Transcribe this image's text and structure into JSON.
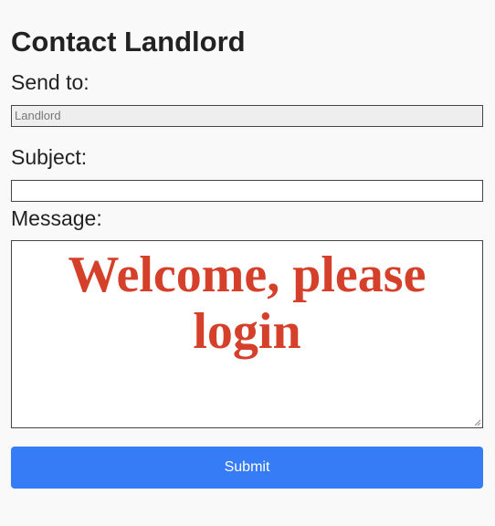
{
  "page": {
    "title": "Contact Landlord"
  },
  "form": {
    "send_to": {
      "label": "Send to:",
      "value": "Landlord"
    },
    "subject": {
      "label": "Subject:",
      "value": ""
    },
    "message": {
      "label": "Message:",
      "value": "Welcome, please login"
    },
    "submit_label": "Submit"
  },
  "colors": {
    "background": "#f9f9f9",
    "submit_button": "#357cf6",
    "message_text": "#d5402b",
    "readonly_field": "#eeeeee"
  },
  "icons": {
    "resize_handle": "textarea-resize-icon"
  }
}
